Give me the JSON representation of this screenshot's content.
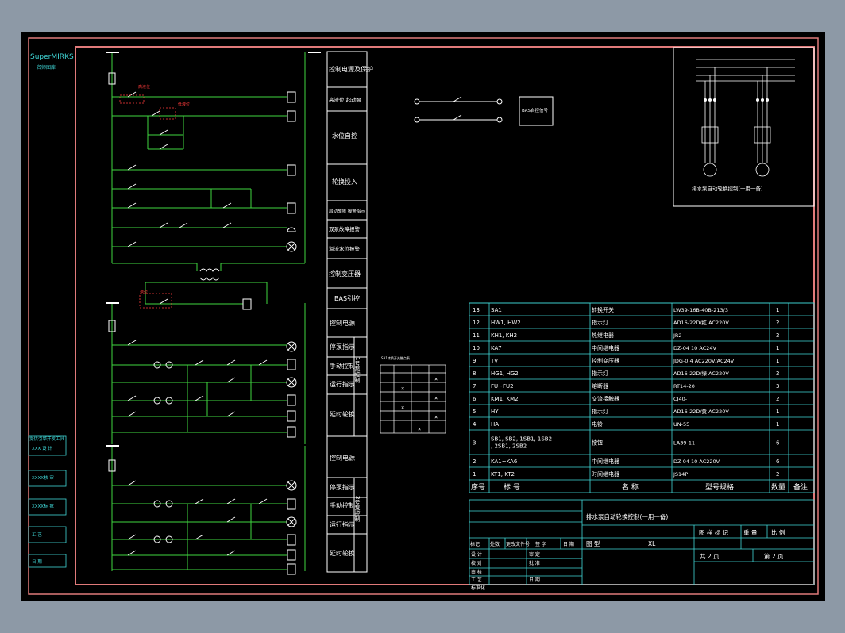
{
  "brand": {
    "name": "SuperMIRKS",
    "sub": "名师图库"
  },
  "left_strip": [
    "提供引擎开发工具",
    "XXX 设 计",
    "XXXX核 审",
    "XXXX标 批",
    "工 艺",
    "日 期"
  ],
  "labels": {
    "control_title": "控制电源及保护",
    "rows_upper": [
      "高液位 起动泵",
      "水位自控",
      "轮换投入",
      "启动故障 报警指示",
      "双泵故障报警",
      "溢流水位报警",
      "控制变压器",
      "BAS引控"
    ],
    "rows_lower": [
      "控制电源",
      "停泵指示",
      "手动控制",
      "运行指示",
      "延时轮换",
      "控制电源",
      "停泵指示",
      "手动控制",
      "运行指示",
      "延时轮换"
    ],
    "pump_group_1": "1号泵控制",
    "pump_group_2": "2号泵控制",
    "motor_title": "排水泵自动轮换控制(一用一备)",
    "bas_box": "BAS自控信号",
    "switch_table_title": "SA1转换开关触点表"
  },
  "bom": {
    "headers": [
      "序号",
      "标 号",
      "名 称",
      "型号规格",
      "数量",
      "备注"
    ],
    "rows": [
      [
        "13",
        "SA1",
        "转换开关",
        "LW39-16B-40B-213/3",
        "1",
        ""
      ],
      [
        "12",
        "HW1, HW2",
        "指示灯",
        "AD16-22D/红 AC220V",
        "2",
        ""
      ],
      [
        "11",
        "KH1, KH2",
        "热继电器",
        "JR2",
        "2",
        ""
      ],
      [
        "10",
        "KA7",
        "中间继电器",
        "DZ-04 10 AC24V",
        "1",
        ""
      ],
      [
        "9",
        "TV",
        "控制变压器",
        "JDG-0.4 AC220V/AC24V",
        "1",
        ""
      ],
      [
        "8",
        "HG1, HG2",
        "指示灯",
        "AD16-22D/绿 AC220V",
        "2",
        ""
      ],
      [
        "7",
        "FU~FU2",
        "熔断器",
        "RT14-20",
        "3",
        ""
      ],
      [
        "6",
        "KM1, KM2",
        "交流接触器",
        "CJ40-",
        "2",
        ""
      ],
      [
        "5",
        "HY",
        "指示灯",
        "AD16-22D/黄 AC220V",
        "1",
        ""
      ],
      [
        "4",
        "HA",
        "电铃",
        "UN-55",
        "1",
        ""
      ],
      [
        "3",
        "SB1, SB2, 1SB1, 1SB2, 2SB1, 2SB2",
        "按钮",
        "LA39-11",
        "6",
        ""
      ],
      [
        "2",
        "KA1~KA6",
        "中间继电器",
        "DZ-04 10 AC220V",
        "6",
        ""
      ],
      [
        "1",
        "KT1, KT2",
        "时间继电器",
        "JS14P",
        "2",
        ""
      ]
    ]
  },
  "title_block": {
    "title": "排水泵自动轮换控制(一用一备)",
    "drawing_mark": "图 样 标 记",
    "weight": "重 量",
    "scale": "比 例",
    "total_pages": "共 2 页",
    "page": "第 2 页",
    "type_label": "图 型",
    "type_value": "XL",
    "change_row": [
      "标记",
      "处数",
      "更改文件号",
      "签 字",
      "日 期"
    ],
    "roles": [
      "设 计",
      "校 对",
      "审 核",
      "工 艺",
      "标准化"
    ],
    "right_roles": [
      "审 定",
      "批 准",
      "",
      "日 期"
    ]
  },
  "colors": {
    "bg": "#000000",
    "border": "#e07a7a",
    "wire": "#3fd63f",
    "white": "#ffffff",
    "red": "#ff3b3b",
    "cyan": "#40d9d9",
    "yellow": "#ffff55"
  }
}
